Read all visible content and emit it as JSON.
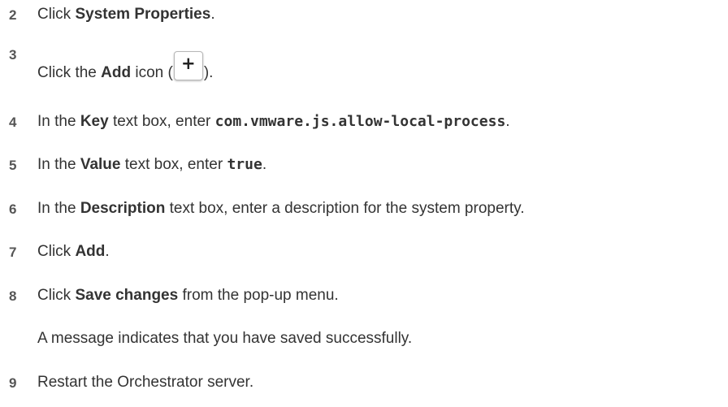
{
  "steps": [
    {
      "number": "2",
      "parts": [
        "Click ",
        "System Properties",
        "."
      ]
    },
    {
      "number": "3",
      "parts": [
        "Click the ",
        "Add",
        " icon (",
        ")."
      ],
      "icon": "plus-icon",
      "icon_glyph": "+"
    },
    {
      "number": "4",
      "parts": [
        "In the ",
        "Key",
        " text box, enter ",
        "com.vmware.js.allow-local-process",
        "."
      ]
    },
    {
      "number": "5",
      "parts": [
        "In the ",
        "Value",
        " text box, enter ",
        "true",
        "."
      ]
    },
    {
      "number": "6",
      "parts": [
        "In the ",
        "Description",
        " text box, enter a description for the system property."
      ]
    },
    {
      "number": "7",
      "parts": [
        "Click ",
        "Add",
        "."
      ]
    },
    {
      "number": "8",
      "parts": [
        "Click ",
        "Save changes",
        " from the pop-up menu."
      ],
      "result": "A message indicates that you have saved successfully."
    },
    {
      "number": "9",
      "parts": [
        "Restart the Orchestrator server."
      ]
    }
  ]
}
